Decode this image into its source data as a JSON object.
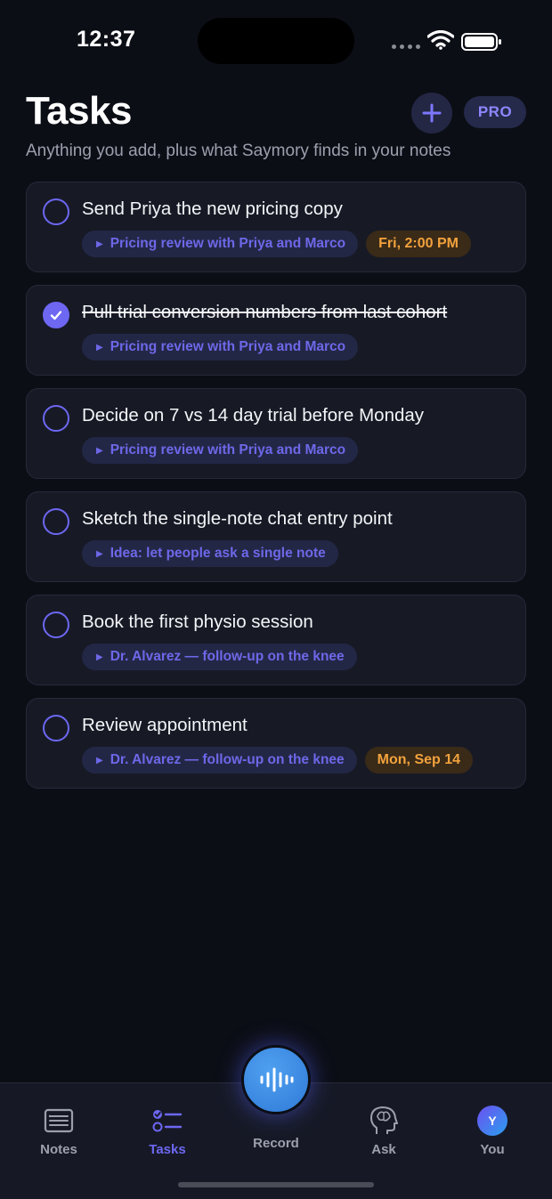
{
  "status_bar": {
    "time": "12:37"
  },
  "header": {
    "title": "Tasks",
    "subtitle": "Anything you add, plus what Saymory finds in your notes",
    "pro_label": "PRO"
  },
  "tasks": [
    {
      "title": "Send Priya the new pricing copy",
      "done": false,
      "note": "Pricing review with Priya and Marco",
      "due": "Fri, 2:00 PM"
    },
    {
      "title": "Pull trial conversion numbers from last cohort",
      "done": true,
      "note": "Pricing review with Priya and Marco",
      "due": ""
    },
    {
      "title": "Decide on 7 vs 14 day trial before Monday",
      "done": false,
      "note": "Pricing review with Priya and Marco",
      "due": ""
    },
    {
      "title": "Sketch the single-note chat entry point",
      "done": false,
      "note": "Idea: let people ask a single note",
      "due": ""
    },
    {
      "title": "Book the first physio session",
      "done": false,
      "note": "Dr. Alvarez — follow-up on the knee",
      "due": ""
    },
    {
      "title": "Review appointment",
      "done": false,
      "note": "Dr. Alvarez — follow-up on the knee",
      "due": "Mon, Sep 14"
    }
  ],
  "tab_bar": {
    "notes": "Notes",
    "tasks": "Tasks",
    "record": "Record",
    "ask": "Ask",
    "you": "You",
    "avatar_initial": "Y"
  },
  "colors": {
    "accent": "#6d67f2",
    "date": "#f2a23c",
    "background": "#0c0e16"
  }
}
